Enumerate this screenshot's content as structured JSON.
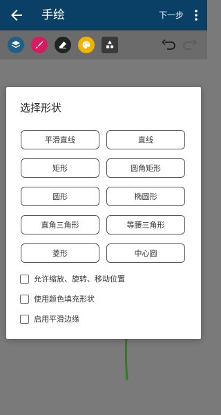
{
  "app_bar": {
    "title": "手绘",
    "next_label": "下一步",
    "colors": {
      "background": "#0a3f66",
      "text": "#ffffff"
    }
  },
  "toolbar": {
    "tools": [
      {
        "icon": "layers-icon",
        "color": "#1f5f8b"
      },
      {
        "icon": "brush-icon",
        "color": "#d81b60"
      },
      {
        "icon": "eraser-icon",
        "color": "#222222"
      },
      {
        "icon": "palette-icon",
        "color": "#f0b400"
      },
      {
        "icon": "shapes-icon",
        "color": "#3a3a3a"
      }
    ],
    "undo_icon": "undo-icon",
    "redo_icon": "redo-icon"
  },
  "dialog": {
    "title": "选择形状",
    "shape_buttons": [
      "平滑直线",
      "直线",
      "矩形",
      "圆角矩形",
      "圆形",
      "椭圆形",
      "直角三角形",
      "等腰三角形",
      "菱形",
      "中心圆"
    ],
    "options": [
      {
        "label": "允许缩放、旋转、移动位置",
        "checked": false
      },
      {
        "label": "使用颜色填充形状",
        "checked": false
      },
      {
        "label": "启用平滑边缘",
        "checked": false
      }
    ]
  }
}
